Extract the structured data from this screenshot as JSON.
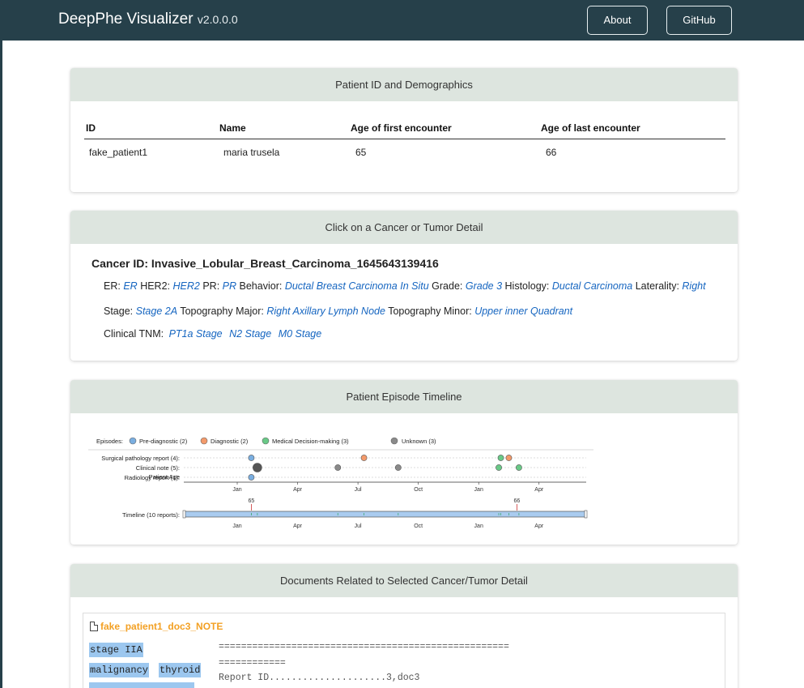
{
  "navbar": {
    "brand": "DeepPhe Visualizer",
    "version": "v2.0.0.0",
    "about_label": "About",
    "github_label": "GitHub"
  },
  "demographics": {
    "header": "Patient ID and Demographics",
    "columns": [
      "ID",
      "Name",
      "Age of first encounter",
      "Age of last encounter"
    ],
    "row": [
      "fake_patient1",
      "maria trusela",
      "65",
      "66"
    ]
  },
  "cancer": {
    "header": "Click on a Cancer or Tumor Detail",
    "title": "Cancer ID: Invasive_Lobular_Breast_Carcinoma_1645643139416",
    "line1": [
      {
        "label": "ER:",
        "value": "ER"
      },
      {
        "label": "HER2:",
        "value": "HER2"
      },
      {
        "label": "PR:",
        "value": "PR"
      },
      {
        "label": "Behavior:",
        "value": "Ductal Breast Carcinoma In Situ"
      },
      {
        "label": "Grade:",
        "value": "Grade 3"
      },
      {
        "label": "Histology:",
        "value": "Ductal Carcinoma"
      },
      {
        "label": "Laterality:",
        "value": "Right"
      }
    ],
    "line2": [
      {
        "label": "Stage:",
        "value": "Stage 2A"
      },
      {
        "label": "Topography Major:",
        "value": "Right Axillary Lymph Node"
      },
      {
        "label": "Topography Minor:",
        "value": "Upper inner Quadrant"
      }
    ],
    "tnm_label": "Clinical TNM:",
    "tnm": [
      "PT1a Stage",
      "N2 Stage",
      "M0 Stage"
    ]
  },
  "timeline": {
    "header": "Patient Episode Timeline",
    "episodes_label": "Episodes:",
    "legend": [
      {
        "label": "Pre-diagnostic (2)",
        "color": "#7aaee0"
      },
      {
        "label": "Diagnostic (2)",
        "color": "#f39a6b"
      },
      {
        "label": "Medical Decision-making (3)",
        "color": "#69c987"
      },
      {
        "label": "Unknown (3)",
        "color": "#8a8a8a"
      }
    ],
    "rows": [
      "Surgical pathology report (4):",
      "Clinical note (5):",
      "Radiology report (1):"
    ],
    "x_ticks": [
      "Jan",
      "Apr",
      "Jul",
      "Oct",
      "Jan",
      "Apr"
    ],
    "age_label": "Patient Age",
    "ages": [
      "65",
      "66"
    ],
    "overview_label": "Timeline (10 reports):"
  },
  "chart_data": {
    "type": "scatter",
    "x_axis_ticks": [
      "Jan",
      "Apr",
      "Jul",
      "Oct",
      "Jan",
      "Apr"
    ],
    "rows": [
      "Surgical pathology report (4):",
      "Clinical note (5):",
      "Radiology report (1):"
    ],
    "points": [
      {
        "row": 0,
        "month": 0.7,
        "episode": "Pre-diagnostic"
      },
      {
        "row": 0,
        "month": 6.3,
        "episode": "Diagnostic"
      },
      {
        "row": 0,
        "month": 13.1,
        "episode": "Medical Decision-making"
      },
      {
        "row": 0,
        "month": 13.5,
        "episode": "Diagnostic"
      },
      {
        "row": 1,
        "month": 1.0,
        "episode": "Unknown",
        "size": "large"
      },
      {
        "row": 1,
        "month": 5.0,
        "episode": "Unknown"
      },
      {
        "row": 1,
        "month": 8.0,
        "episode": "Unknown"
      },
      {
        "row": 1,
        "month": 13.0,
        "episode": "Medical Decision-making"
      },
      {
        "row": 1,
        "month": 14.0,
        "episode": "Medical Decision-making"
      },
      {
        "row": 2,
        "month": 0.7,
        "episode": "Pre-diagnostic"
      }
    ],
    "age_markers": [
      {
        "label": "65",
        "month": 0.7
      },
      {
        "label": "66",
        "month": 13.9
      }
    ]
  },
  "documents": {
    "header": "Documents Related to Selected Cancer/Tumor Detail",
    "doc_title": "fake_patient1_doc3_NOTE",
    "tags": [
      "stage IIA",
      "malignancy",
      "thyroid"
    ],
    "lines": [
      "====================================================",
      "============",
      "Report ID.....................3,doc3"
    ]
  }
}
